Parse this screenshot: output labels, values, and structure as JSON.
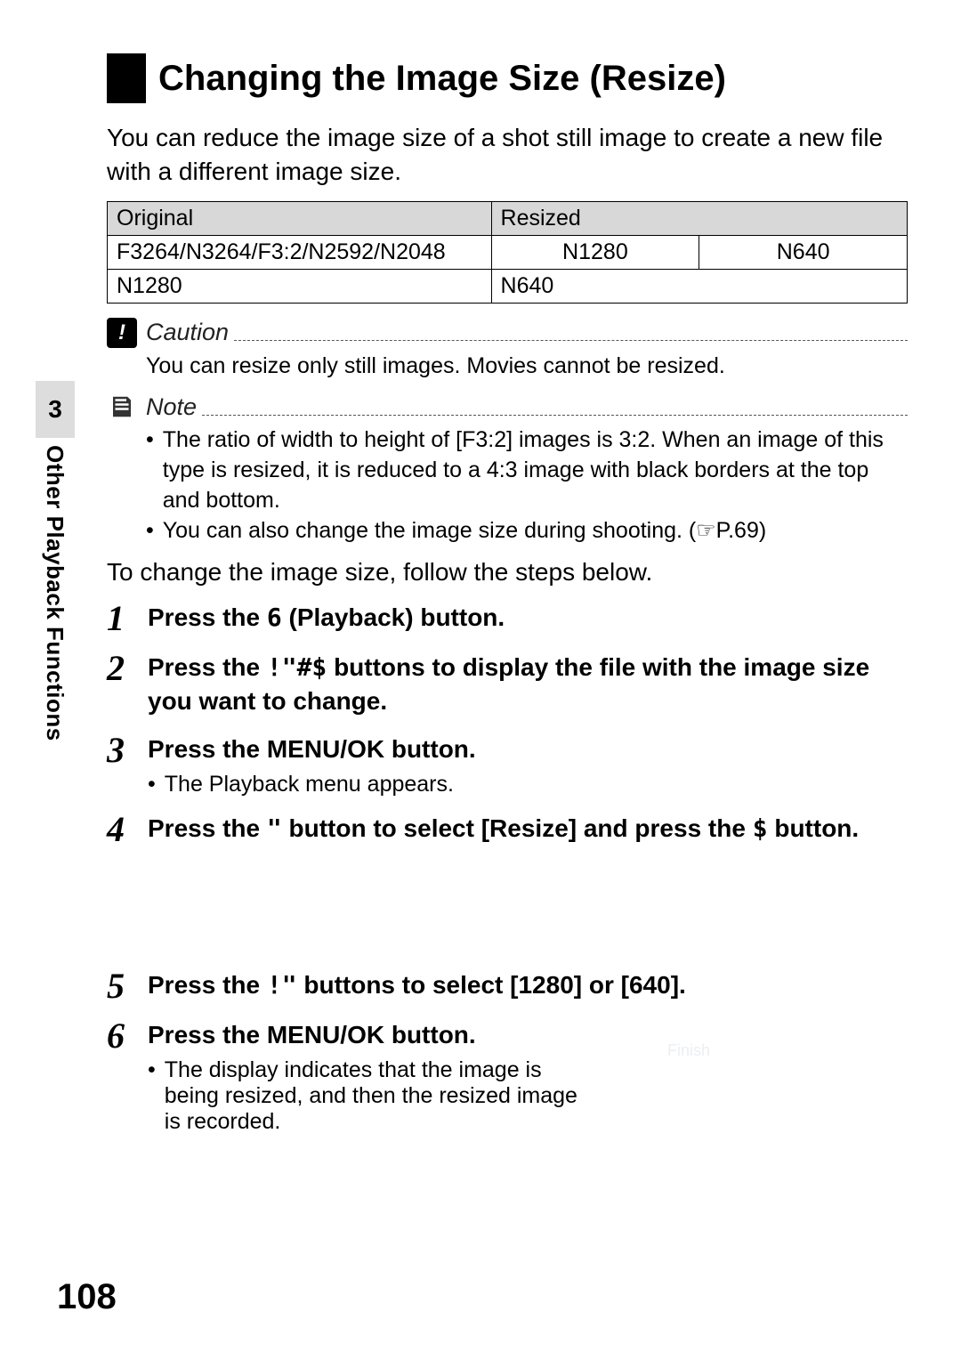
{
  "sidebar": {
    "section_number": "3",
    "section_label": "Other Playback Functions"
  },
  "title": "Changing the Image Size (Resize)",
  "intro": "You can reduce the image size of a shot still image to create a new file with a different image size.",
  "table": {
    "headers": {
      "original": "Original",
      "resized": "Resized"
    },
    "rows": [
      {
        "original": "F3264/N3264/F3:2/N2592/N2048",
        "r1": "N1280",
        "r2": "N640"
      },
      {
        "original": "N1280",
        "r1": "N640",
        "r2": ""
      }
    ]
  },
  "caution": {
    "label": "Caution",
    "body": "You can resize only still images. Movies cannot be resized."
  },
  "note": {
    "label": "Note",
    "items": [
      "The ratio of width to height of [F3:2] images is 3:2. When an image of this type is resized, it is reduced to a 4:3 image with black borders at the top and bottom.",
      "You can also change the image size during shooting. (☞P.69)"
    ]
  },
  "lead_in": "To change the image size, follow the steps below.",
  "steps": [
    {
      "num": "1",
      "title_parts": [
        "Press the ",
        "6",
        " (Playback) button."
      ]
    },
    {
      "num": "2",
      "title_parts": [
        "Press the ",
        "!\"#$",
        " buttons to display the file with the image size you want to change."
      ]
    },
    {
      "num": "3",
      "title_parts": [
        "Press the MENU/OK button."
      ],
      "sub": "The Playback menu appears."
    },
    {
      "num": "4",
      "title_parts": [
        "Press the ",
        "\"",
        " button to select [Resize] and press the ",
        "$",
        " button."
      ]
    },
    {
      "num": "5",
      "title_parts": [
        "Press the ",
        "!\"",
        " buttons to select [1280] or [640]."
      ]
    },
    {
      "num": "6",
      "title_parts": [
        "Press the MENU/OK button."
      ],
      "sub": "The display indicates that the image is being resized, and then the resized image is recorded."
    }
  ],
  "screen": {
    "finish_label": "Finish"
  },
  "page_number": "108"
}
